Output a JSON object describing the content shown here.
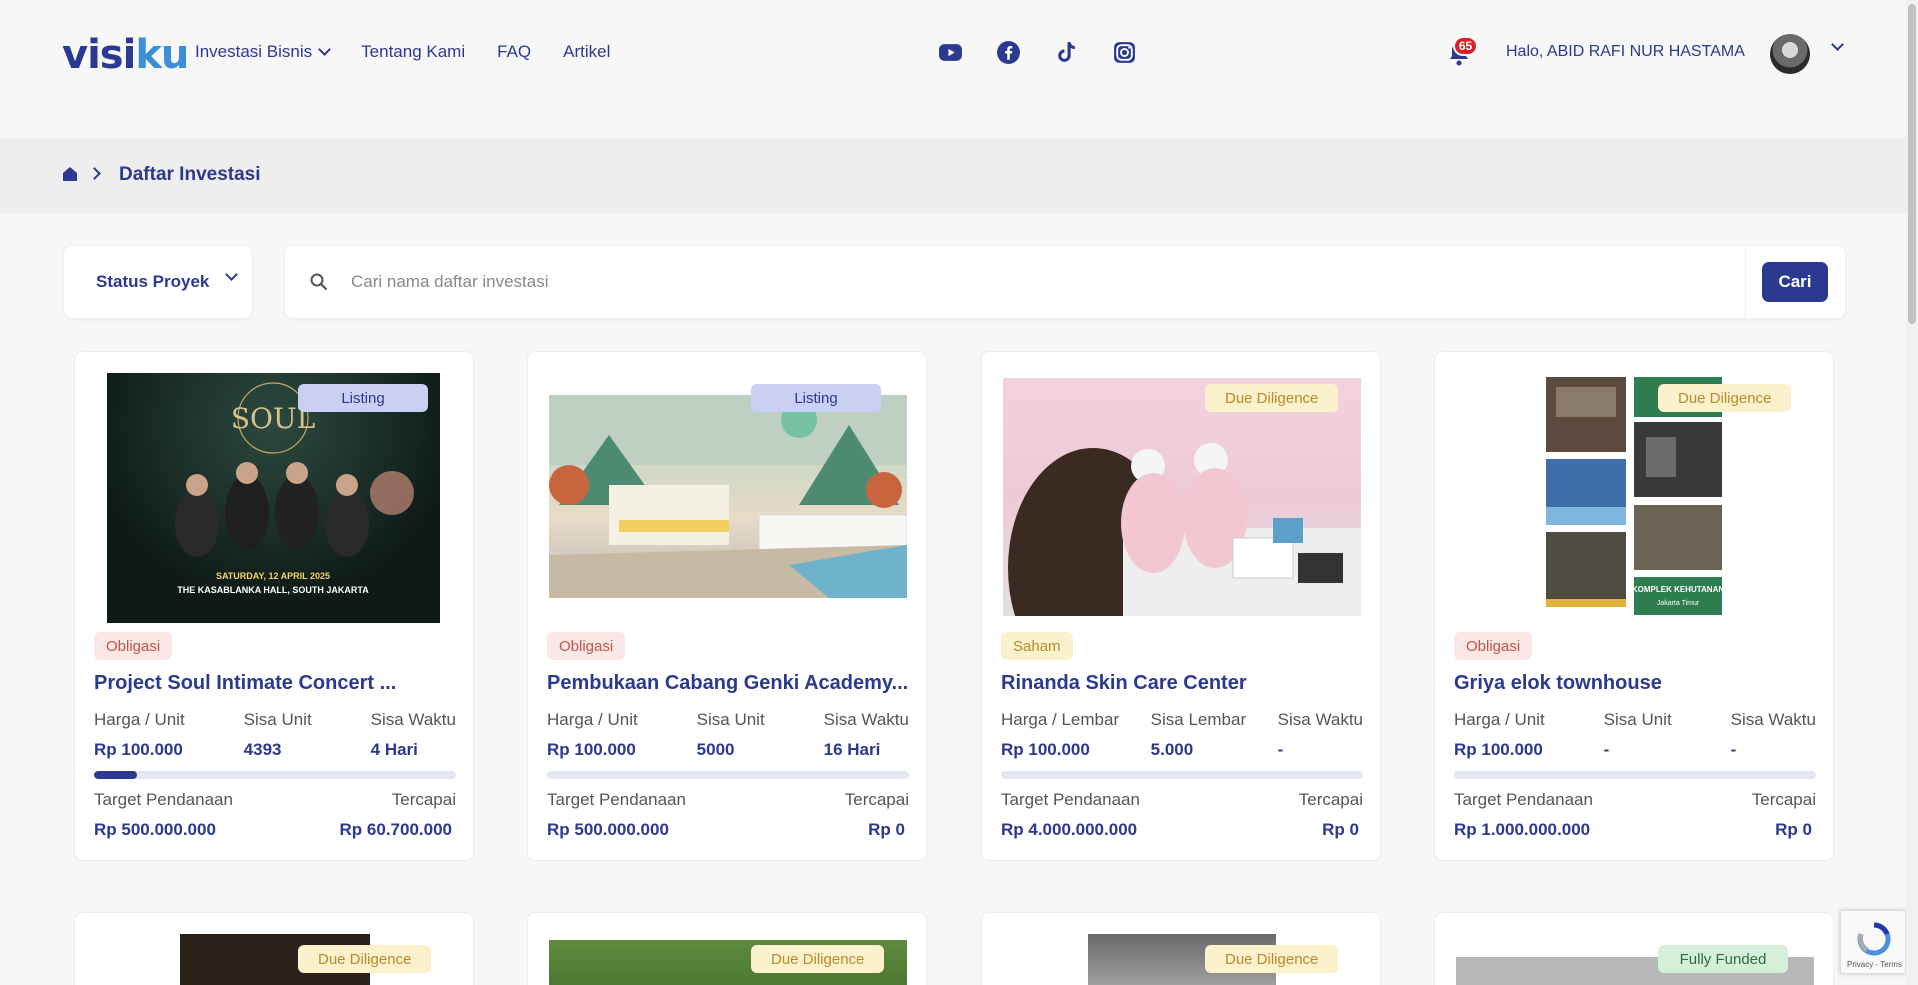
{
  "header": {
    "logo_main": "visi",
    "logo_accent": "ku",
    "nav": [
      "Investasi Bisnis",
      "Tentang Kami",
      "FAQ",
      "Artikel"
    ],
    "notification_count": "65",
    "greeting": "Halo, ABID RAFI NUR HASTAMA",
    "socials": [
      "youtube-icon",
      "facebook-icon",
      "tiktok-icon",
      "instagram-icon"
    ]
  },
  "breadcrumb": {
    "title": "Daftar Investasi"
  },
  "filter": {
    "status_label": "Status Proyek",
    "search_placeholder": "Cari nama daftar investasi",
    "search_button": "Cari"
  },
  "cards": [
    {
      "status": "Listing",
      "type": "Obligasi",
      "title": "Project Soul Intimate Concert ...",
      "stat1_label": "Harga / Unit",
      "stat1_value": "Rp 100.000",
      "stat2_label": "Sisa Unit",
      "stat2_value": "4393",
      "stat3_label": "Sisa Waktu",
      "stat3_value": "4 Hari",
      "progress": 0.12,
      "target_label": "Target Pendanaan",
      "target_value": "Rp 500.000.000",
      "reached_label": "Tercapai",
      "reached_value": "Rp 60.700.000",
      "poster_title": "SOUL",
      "poster_date": "SATURDAY, 12 APRIL 2025",
      "poster_venue": "THE KASABLANKA HALL, SOUTH JAKARTA"
    },
    {
      "status": "Listing",
      "type": "Obligasi",
      "title": "Pembukaan Cabang Genki Academy...",
      "stat1_label": "Harga / Unit",
      "stat1_value": "Rp 100.000",
      "stat2_label": "Sisa Unit",
      "stat2_value": "5000",
      "stat3_label": "Sisa Waktu",
      "stat3_value": "16 Hari",
      "progress": 0,
      "target_label": "Target Pendanaan",
      "target_value": "Rp 500.000.000",
      "reached_label": "Tercapai",
      "reached_value": "Rp 0"
    },
    {
      "status": "Due Diligence",
      "type": "Saham",
      "title": "Rinanda Skin Care Center",
      "stat1_label": "Harga / Lembar",
      "stat1_value": "Rp 100.000",
      "stat2_label": "Sisa Lembar",
      "stat2_value": "5.000",
      "stat3_label": "Sisa Waktu",
      "stat3_value": "-",
      "progress": 0,
      "target_label": "Target Pendanaan",
      "target_value": "Rp 4.000.000.000",
      "reached_label": "Tercapai",
      "reached_value": "Rp 0"
    },
    {
      "status": "Due Diligence",
      "type": "Obligasi",
      "title": "Griya elok townhouse",
      "stat1_label": "Harga / Unit",
      "stat1_value": "Rp 100.000",
      "stat2_label": "Sisa Unit",
      "stat2_value": "-",
      "stat3_label": "Sisa Waktu",
      "stat3_value": "-",
      "progress": 0,
      "target_label": "Target Pendanaan",
      "target_value": "Rp 1.000.000.000",
      "reached_label": "Tercapai",
      "reached_value": "Rp 0",
      "photo_sign_1": "KOMPLEK KEHUTANAN",
      "photo_sign_2": "Jakarta Timur"
    }
  ],
  "second_row_status": [
    "Due Diligence",
    "Due Diligence",
    "Due Diligence",
    "Fully Funded"
  ],
  "recaptcha_text": "Privacy - Terms",
  "colors": {
    "primary": "#2b3990",
    "accent": "#3a8fd8",
    "badge": "#d8222a"
  }
}
